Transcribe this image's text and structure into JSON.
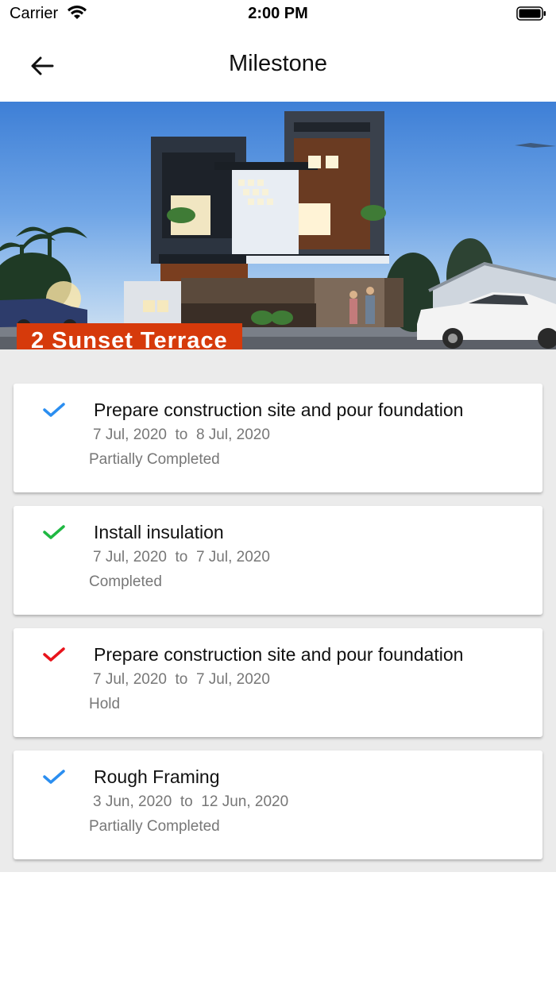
{
  "status_bar": {
    "carrier": "Carrier",
    "time": "2:00 PM"
  },
  "nav": {
    "title": "Milestone"
  },
  "project": {
    "name": "2 Sunset Terrace"
  },
  "colors": {
    "badge": "#d63a0b",
    "blue_check": "#2b8ef0",
    "green_check": "#1fb842",
    "red_check": "#e8141c"
  },
  "milestones": [
    {
      "title": "Prepare construction site and pour foundation",
      "start": "7 Jul, 2020",
      "to": "to",
      "end": "8 Jul, 2020",
      "status": "Partially Completed",
      "check_color": "#2b8ef0"
    },
    {
      "title": "Install insulation",
      "start": "7 Jul, 2020",
      "to": "to",
      "end": "7 Jul, 2020",
      "status": "Completed",
      "check_color": "#1fb842"
    },
    {
      "title": "Prepare construction site and pour foundation",
      "start": "7 Jul, 2020",
      "to": "to",
      "end": "7 Jul, 2020",
      "status": "Hold",
      "check_color": "#e8141c"
    },
    {
      "title": "Rough Framing",
      "start": "3 Jun, 2020",
      "to": "to",
      "end": "12 Jun, 2020",
      "status": "Partially Completed",
      "check_color": "#2b8ef0"
    }
  ]
}
